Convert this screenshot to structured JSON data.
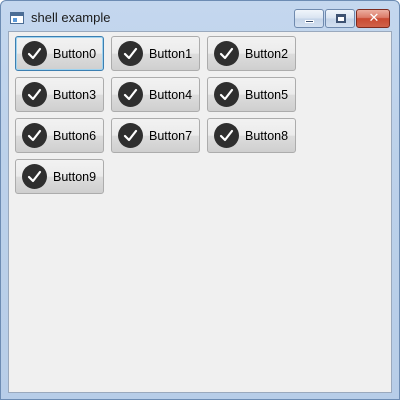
{
  "window": {
    "title": "shell example",
    "controls": {
      "minimize": "minimize",
      "maximize": "maximize",
      "close": "close"
    }
  },
  "buttons": [
    {
      "label": "Button0",
      "icon": "check-circle-icon",
      "focused": true
    },
    {
      "label": "Button1",
      "icon": "check-circle-icon"
    },
    {
      "label": "Button2",
      "icon": "check-circle-icon"
    },
    {
      "label": "Button3",
      "icon": "check-circle-icon"
    },
    {
      "label": "Button4",
      "icon": "check-circle-icon"
    },
    {
      "label": "Button5",
      "icon": "check-circle-icon"
    },
    {
      "label": "Button6",
      "icon": "check-circle-icon"
    },
    {
      "label": "Button7",
      "icon": "check-circle-icon"
    },
    {
      "label": "Button8",
      "icon": "check-circle-icon"
    },
    {
      "label": "Button9",
      "icon": "check-circle-icon"
    }
  ],
  "colors": {
    "icon_bg": "#2f2f2f",
    "focus_border": "#3c7fb1",
    "client_bg": "#f0f0f0"
  }
}
